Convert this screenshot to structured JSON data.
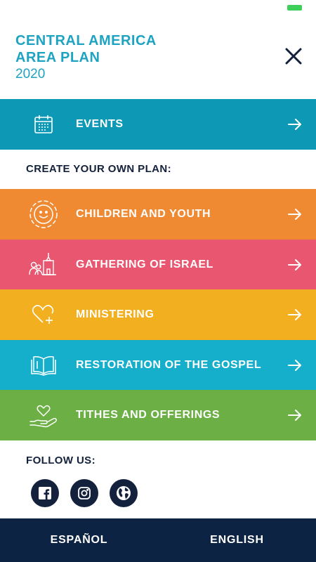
{
  "header": {
    "title_line1": "CENTRAL AMERICA",
    "title_line2": "AREA PLAN",
    "year": "2020",
    "close_icon": "close-icon"
  },
  "colors": {
    "events": "#0d98b6",
    "children": "#ef8a33",
    "gathering": "#e8566f",
    "ministering": "#f2af20",
    "restoration": "#15aecb",
    "tithes": "#6cb045",
    "navy": "#13213c",
    "title": "#1ea3c2"
  },
  "events": {
    "label": "EVENTS",
    "icon": "calendar-icon"
  },
  "create_heading": "CREATE YOUR OWN PLAN:",
  "plans": [
    {
      "label": "CHILDREN AND YOUTH",
      "icon": "smiley-face-icon"
    },
    {
      "label": "GATHERING OF ISRAEL",
      "icon": "people-temple-icon"
    },
    {
      "label": "MINISTERING",
      "icon": "heart-plus-icon"
    },
    {
      "label": "RESTORATION OF THE GOSPEL",
      "icon": "open-book-icon"
    },
    {
      "label": "TITHES AND OFFERINGS",
      "icon": "hand-heart-icon"
    }
  ],
  "follow_heading": "FOLLOW US:",
  "social": [
    {
      "icon": "facebook-icon"
    },
    {
      "icon": "instagram-icon"
    },
    {
      "icon": "globe-icon"
    }
  ],
  "footer": {
    "spanish": "ESPAÑOL",
    "english": "ENGLISH"
  }
}
